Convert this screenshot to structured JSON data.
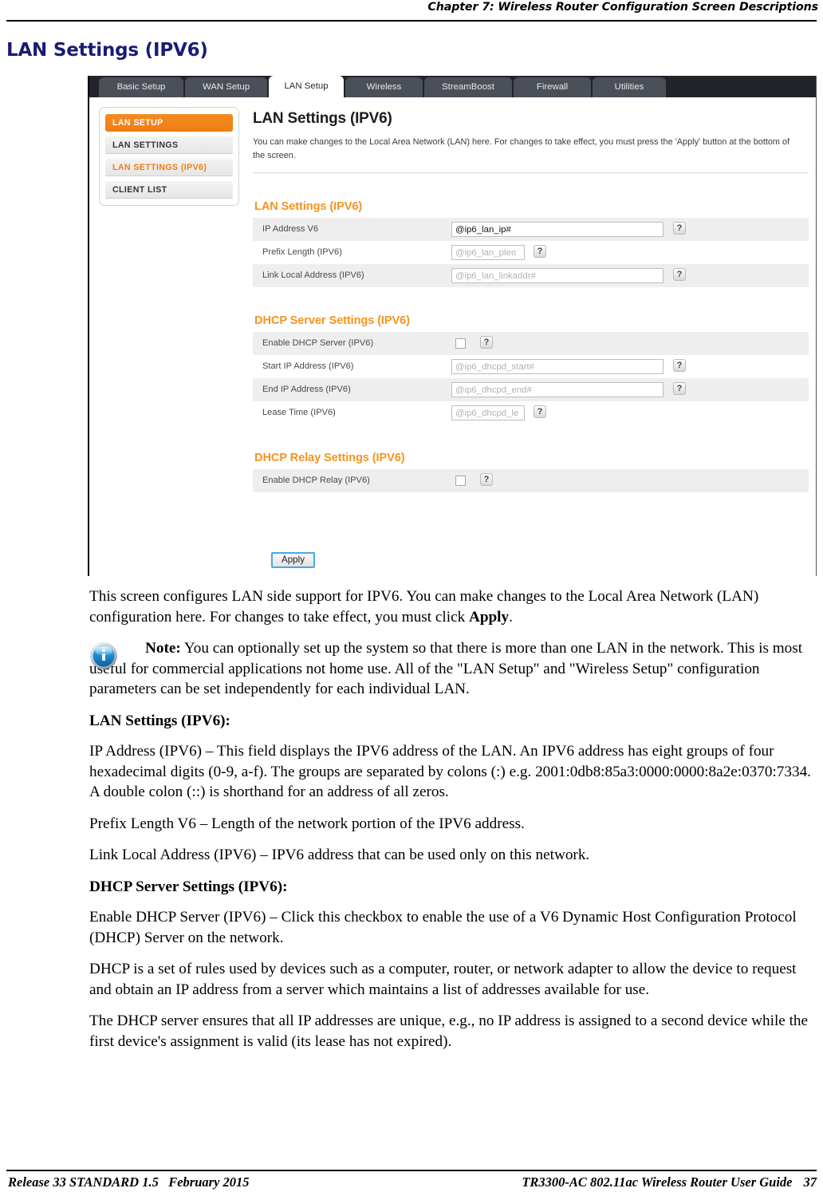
{
  "header": {
    "chapter": "Chapter 7: Wireless Router Configuration Screen Descriptions"
  },
  "page_title": "LAN Settings (IPV6)",
  "screenshot": {
    "tabs": [
      {
        "label": "Basic Setup",
        "active": false
      },
      {
        "label": "WAN Setup",
        "active": false
      },
      {
        "label": "LAN Setup",
        "active": true
      },
      {
        "label": "Wireless",
        "active": false
      },
      {
        "label": "StreamBoost",
        "active": false
      },
      {
        "label": "Firewall",
        "active": false
      },
      {
        "label": "Utilities",
        "active": false
      }
    ],
    "sidebar": {
      "heading": "LAN SETUP",
      "items": [
        {
          "label": "LAN SETTINGS",
          "selected": false
        },
        {
          "label": "LAN SETTINGS (IPV6)",
          "selected": true
        },
        {
          "label": "CLIENT LIST",
          "selected": false
        }
      ]
    },
    "panel": {
      "title": "LAN Settings (IPV6)",
      "description": "You can make changes to the Local Area Network (LAN) here. For changes to take effect, you must press the 'Apply' button at the bottom of the screen.",
      "sections": [
        {
          "title": "LAN Settings (IPV6)",
          "rows": [
            {
              "label": "IP Address V6",
              "control": "text",
              "value": "@ip6_lan_ip#",
              "filled": true,
              "width": "wide",
              "help": "?"
            },
            {
              "label": "Prefix Length (IPV6)",
              "control": "text",
              "value": "@ip6_lan_plen",
              "filled": false,
              "width": "narrow",
              "help": "?"
            },
            {
              "label": "Link Local Address (IPV6)",
              "control": "text",
              "value": "@ip6_lan_linkaddr#",
              "filled": false,
              "width": "wide",
              "help": "?"
            }
          ]
        },
        {
          "title": "DHCP Server Settings (IPV6)",
          "rows": [
            {
              "label": "Enable DHCP Server (IPV6)",
              "control": "checkbox",
              "checked": false,
              "help": "?"
            },
            {
              "label": "Start IP Address (IPV6)",
              "control": "text",
              "value": "@ip6_dhcpd_start#",
              "filled": false,
              "width": "wide",
              "help": "?"
            },
            {
              "label": "End IP Address (IPV6)",
              "control": "text",
              "value": "@ip6_dhcpd_end#",
              "filled": false,
              "width": "wide",
              "help": "?"
            },
            {
              "label": "Lease Time (IPV6)",
              "control": "text",
              "value": "@ip6_dhcpd_le",
              "filled": false,
              "width": "narrow",
              "help": "?"
            }
          ]
        },
        {
          "title": "DHCP Relay Settings (IPV6)",
          "rows": [
            {
              "label": "Enable DHCP Relay (IPV6)",
              "control": "checkbox",
              "checked": false,
              "help": "?"
            }
          ]
        }
      ],
      "apply_label": "Apply"
    }
  },
  "body": {
    "intro_1": "This screen configures LAN side support for IPV6.  You can make changes to the Local Area Network (LAN) configuration here.  For changes to take effect, you must click ",
    "intro_1_bold": "Apply",
    "intro_1_end": ".",
    "note_label": "Note:",
    "note_text": "  You can optionally set up the system so that there is more than one LAN in the network.  This is most useful for commercial applications not home use.  All of the \"LAN Setup\" and \"Wireless Setup\" configuration parameters can be set independently for each individual LAN.",
    "head_lan": "LAN Settings (IPV6):",
    "p_ip_address": "IP Address (IPV6) – This field displays the IPV6 address of the LAN.  An IPV6 address has eight groups of four hexadecimal digits (0-9, a-f).  The groups are separated by colons (:) e.g. 2001:0db8:85a3:0000:0000:8a2e:0370:7334.  A double colon (::) is shorthand for an address of all zeros.",
    "p_prefix": "Prefix Length V6 – Length of the network portion of the IPV6 address.",
    "p_linklocal": "Link Local Address (IPV6) – IPV6 address that can be used only on this network.",
    "head_dhcp": "DHCP Server Settings (IPV6):",
    "p_enable_dhcp": "Enable DHCP Server (IPV6) – Click this checkbox to enable the use of a V6 Dynamic Host Configuration Protocol (DHCP) Server on the network.",
    "p_dhcp_rules": "DHCP is a set of rules used by devices such as a computer, router, or network adapter to allow the device to request and obtain an IP address from a server which maintains a list of addresses available for use.",
    "p_dhcp_unique": "The DHCP server ensures that all IP addresses are unique, e.g., no IP address is assigned to a second device while the first device's assignment is valid (its lease has not expired)."
  },
  "footer": {
    "release": "Release 33 STANDARD 1.5",
    "date": "February 2015",
    "guide": "TR3300-AC 802.11ac Wireless Router User Guide",
    "page_number": "37"
  },
  "colors": {
    "title_navy": "#1b1b74",
    "accent_orange": "#f6941e",
    "tab_dark": "#4b4f58",
    "tabbar_bg": "#222429",
    "row_alt": "#eeeeee"
  }
}
